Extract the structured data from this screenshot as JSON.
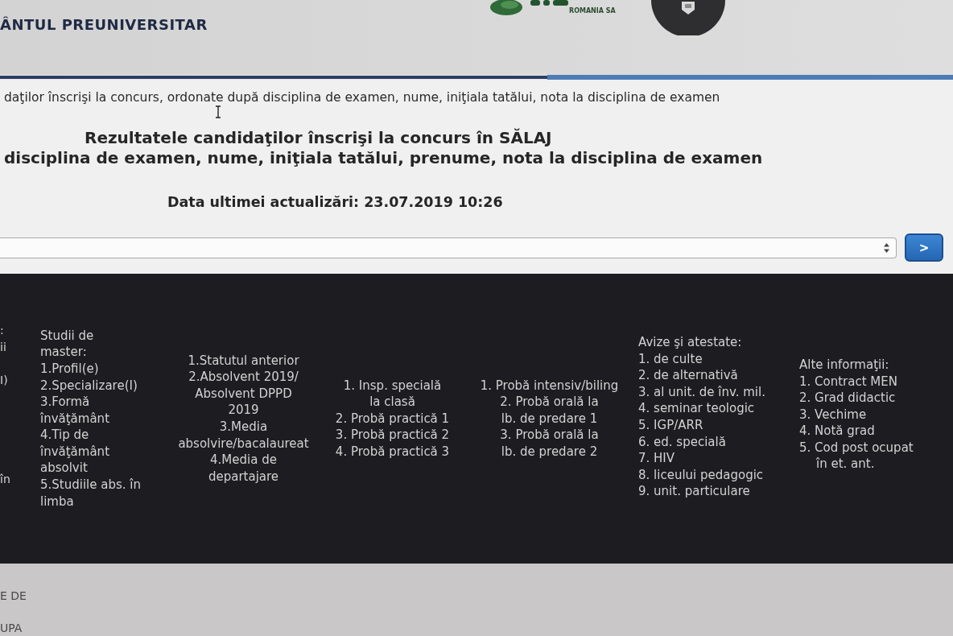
{
  "header": {
    "title": "ÂNTUL PREUNIVERSITAR",
    "logo_caption": "ROMANIA SA"
  },
  "intro": "daţilor înscrişi la concurs, ordonate după disciplina de examen, nume, iniţiala tatălui, nota la disciplina de examen",
  "heading": [
    "Rezultatele candidaţilor înscrişi la concurs în SĂLAJ",
    "disciplina de examen, nume, iniţiala tatălui, prenume, nota la disciplina de examen"
  ],
  "last_update": "Data ultimei actualizări: 23.07.2019 10:26",
  "selector": {
    "button": ">"
  },
  "table": {
    "columns": [
      {
        "lines": [
          ":",
          "ii",
          "I)",
          "în"
        ]
      },
      {
        "lines": [
          "Studii de",
          "master:",
          "1.Profil(e)",
          "2.Specializare(I)",
          "3.Formă",
          "învăţământ",
          "4.Tip de",
          "învăţământ",
          "absolvit",
          "5.Studiile abs. în",
          "limba"
        ]
      },
      {
        "lines": [
          "1.Statutul anterior",
          "2.Absolvent 2019/",
          "Absolvent DPPD",
          "2019",
          "3.Media",
          "absolvire/bacalaureat",
          "4.Media de",
          "departajare"
        ]
      },
      {
        "lines": [
          "1. Insp. specială",
          "la clasă",
          "2. Probă practică 1",
          "3. Probă practică 2",
          "4. Probă practică 3"
        ]
      },
      {
        "lines": [
          "1. Probă intensiv/biling",
          "2. Probă orală la",
          "lb. de predare 1",
          "3. Probă orală la",
          "lb. de predare 2"
        ]
      },
      {
        "lines": [
          "Avize şi atestate:",
          "1. de culte",
          "2. de alternativă",
          "3. al unit. de înv. mil.",
          "4. seminar teologic",
          "5. IGP/ARR",
          "6. ed. specială",
          "7. HIV",
          "8. liceului pedagogic",
          "9. unit. particulare"
        ]
      },
      {
        "lines": [
          "Alte informaţii:",
          "1. Contract MEN",
          "2. Grad didactic",
          "3. Vechime",
          "4. Notă grad",
          "5. Cod post ocupat în et. ant."
        ]
      }
    ]
  },
  "below": [
    "E DE",
    "UPA"
  ]
}
